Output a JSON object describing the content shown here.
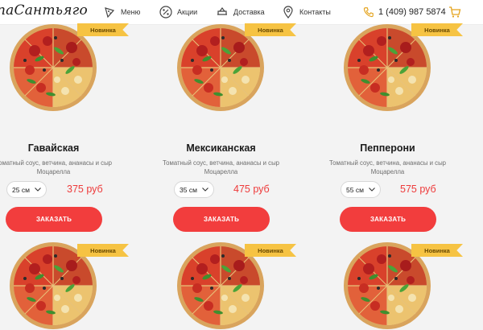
{
  "header": {
    "logo_text": "паСантьяго",
    "nav": [
      {
        "label": "Меню"
      },
      {
        "label": "Акции"
      },
      {
        "label": "Доставка"
      },
      {
        "label": "Контакты"
      }
    ],
    "phone": "1 (409) 987 5874"
  },
  "products": [
    {
      "badge": "Новинка",
      "name": "Гавайская",
      "desc_line1": "Томатный соус, ветчина, ананасы и сыр",
      "desc_line2": "Моцарелла",
      "size": "25 см",
      "price": "375 руб",
      "button": "ЗАКАЗАТЬ"
    },
    {
      "badge": "Новинка",
      "name": "Мексиканская",
      "desc_line1": "Томатный соус, ветчина, ананасы и сыр",
      "desc_line2": "Моцарелла",
      "size": "35 см",
      "price": "475 руб",
      "button": "ЗАКАЗАТЬ"
    },
    {
      "badge": "Новинка",
      "name": "Пепперони",
      "desc_line1": "Томатный соус, ветчина, ананасы и сыр",
      "desc_line2": "Моцарелла",
      "size": "55 см",
      "price": "575 руб",
      "button": "ЗАКАЗАТЬ"
    },
    {
      "badge": "Новинка"
    },
    {
      "badge": "Новинка"
    },
    {
      "badge": "Новинка"
    }
  ],
  "colors": {
    "accent_red": "#f23d3d",
    "price_red": "#ee3a3a",
    "badge_yellow": "#f6c343",
    "background": "#f3f3f3"
  }
}
